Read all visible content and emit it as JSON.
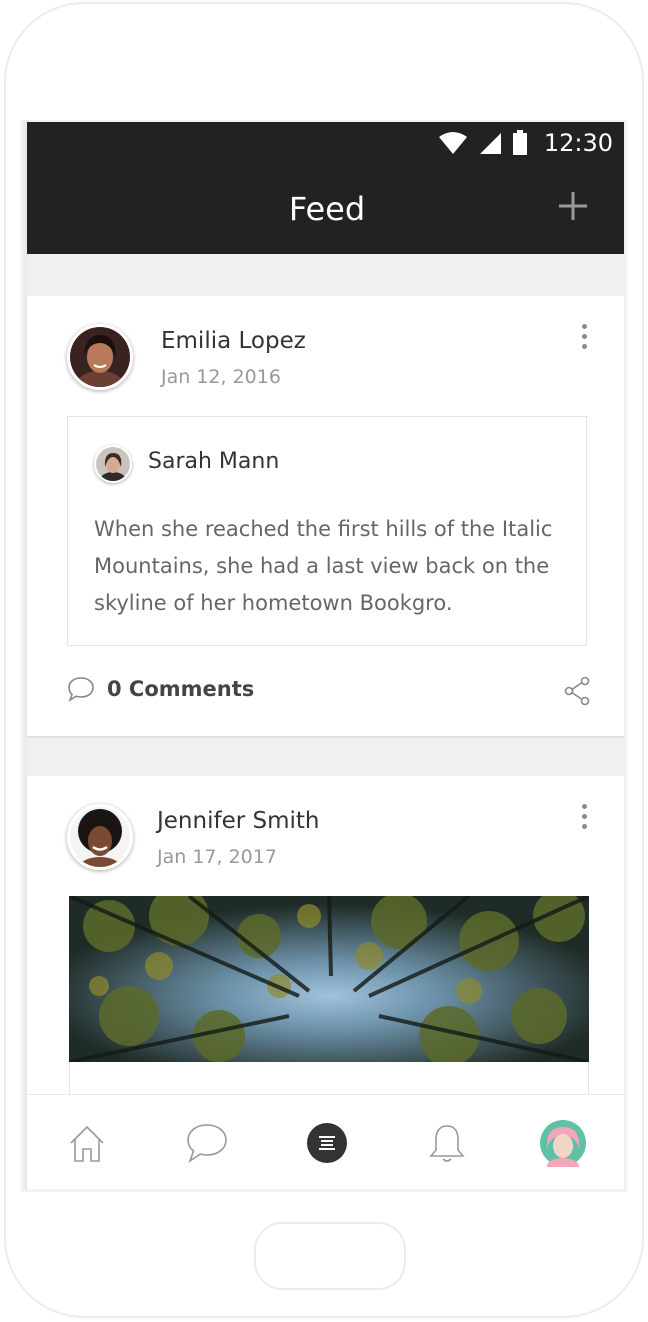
{
  "status_bar": {
    "time": "12:30",
    "icons": [
      "wifi-icon",
      "cellular-signal-icon",
      "battery-icon"
    ]
  },
  "app_bar": {
    "title": "Feed",
    "action_icon": "plus-icon"
  },
  "posts": [
    {
      "author": "Emilia Lopez",
      "date": "Jan 12, 2016",
      "shared": {
        "author": "Sarah Mann",
        "text": "When she reached the first hills of the Italic Mountains, she had a last view back on the skyline of her hometown Bookgro."
      },
      "comments_label": "0 Comments"
    },
    {
      "author": "Jennifer Smith",
      "date": "Jan 17, 2017"
    }
  ],
  "tab_bar": {
    "items": [
      "home-icon",
      "chat-icon",
      "feed-icon",
      "bell-icon",
      "profile-avatar"
    ],
    "active": "feed-icon"
  },
  "colors": {
    "appbar": "#222222",
    "background": "#f0f0f0",
    "card": "#ffffff",
    "muted_text": "#999999"
  }
}
